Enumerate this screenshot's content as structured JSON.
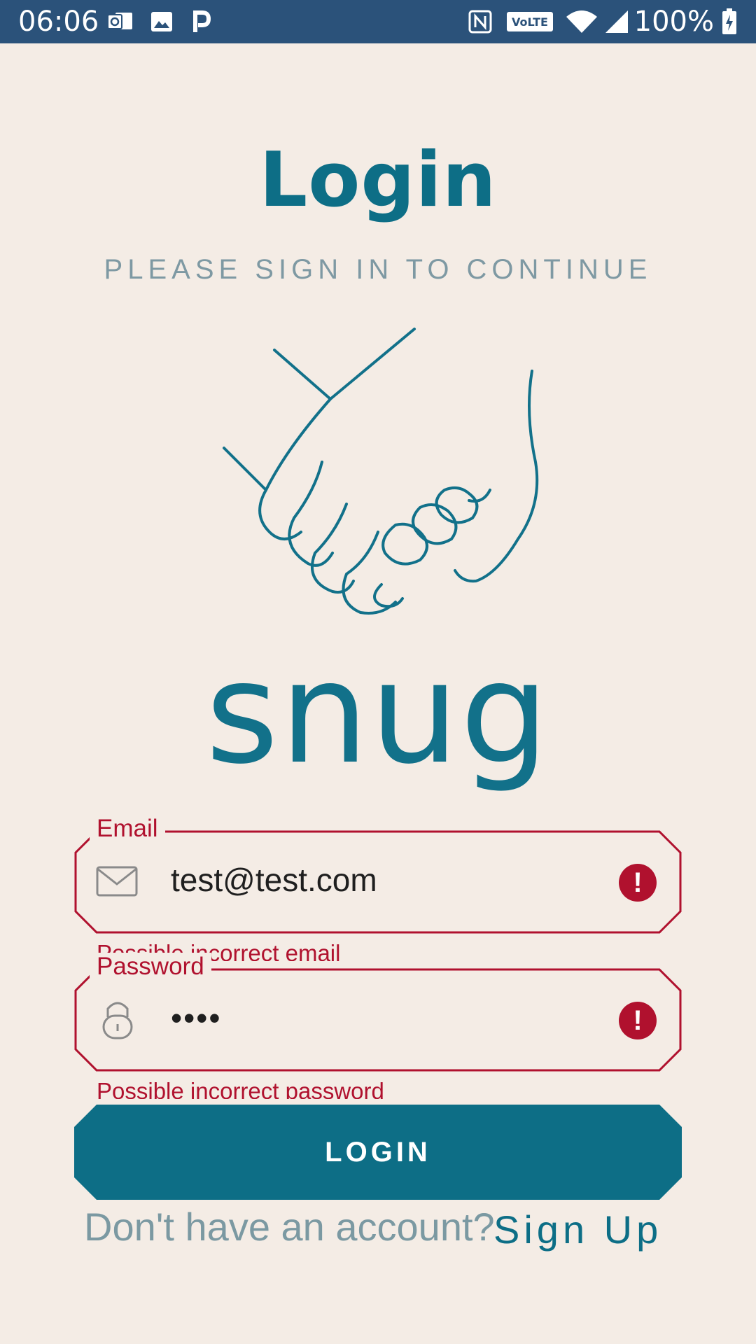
{
  "status_bar": {
    "time": "06:06",
    "battery": "100%",
    "icons": [
      "outlook-icon",
      "image-icon",
      "p-icon",
      "nfc-icon",
      "volte-icon",
      "wifi-icon",
      "signal-icon",
      "battery-icon"
    ]
  },
  "header": {
    "title": "Login",
    "subtitle": "PLEASE SIGN IN TO CONTINUE"
  },
  "logo": {
    "wordmark": "snug",
    "color": "#12718a"
  },
  "form": {
    "email": {
      "label": "Email",
      "value": "test@test.com",
      "error": "Possible incorrect email"
    },
    "password": {
      "label": "Password",
      "value": "••••",
      "error": "Possible incorrect password"
    },
    "login_label": "LOGIN"
  },
  "footer": {
    "prompt": "Don't have an account?",
    "signup_label": "Sign Up"
  },
  "colors": {
    "background": "#f4ece5",
    "primary": "#0d6e86",
    "error": "#b0112e",
    "status_bar": "#2b527a"
  }
}
